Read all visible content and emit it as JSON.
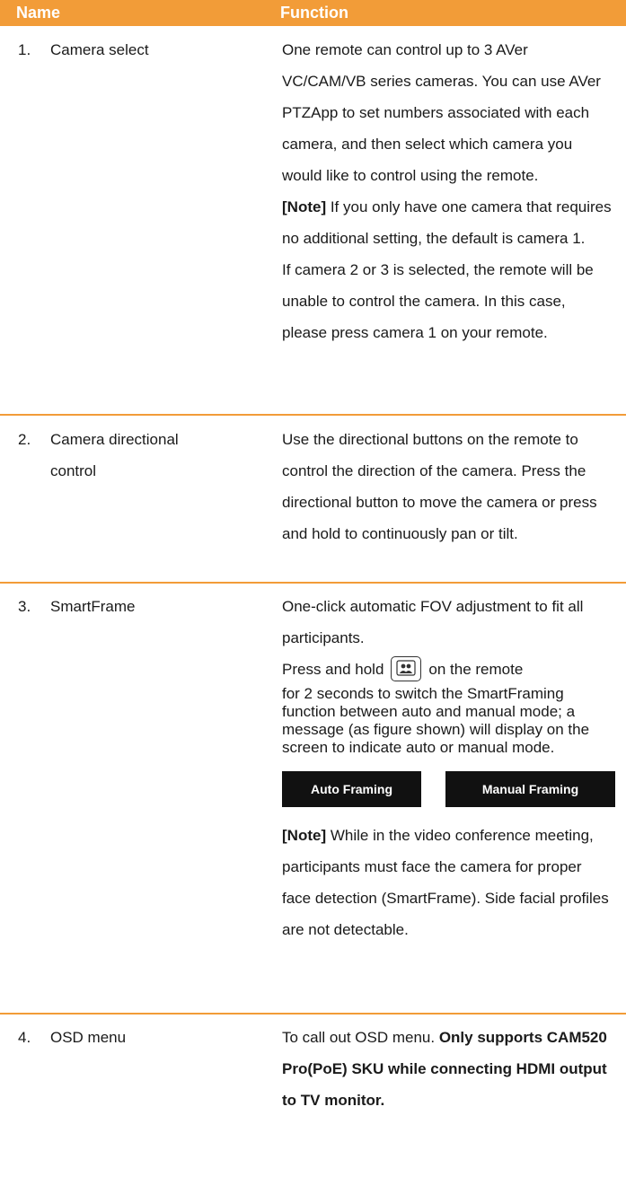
{
  "header": {
    "name": "Name",
    "function": "Function"
  },
  "rows": [
    {
      "num": "1.",
      "name": "Camera select",
      "desc": "One remote can control up to 3 AVer VC/CAM/VB series cameras. You can use AVer PTZApp to set numbers associated with each camera, and then select which camera you would like to control using the remote.",
      "note_label": "[Note]",
      "note_text": " If you only have one camera that requires no additional setting, the default is camera 1.",
      "extra": "If camera 2 or 3 is selected, the remote will be unable to control the camera. In this case, please press camera 1 on your remote."
    },
    {
      "num": "2.",
      "name_line1": "Camera directional",
      "name_line2": "control",
      "desc": "Use the directional buttons on the remote to control the direction of the camera. Press the directional button to move the camera or press and hold to continuously pan or tilt."
    },
    {
      "num": "3.",
      "name": "SmartFrame",
      "desc": "One-click automatic FOV adjustment to fit all participants.",
      "press_before": "Press and hold",
      "press_after": "on the remote",
      "press_rest": "for 2 seconds to switch the SmartFraming function between auto and manual mode; a message (as figure shown) will display on the screen to indicate auto or manual mode.",
      "badge_auto": "Auto Framing",
      "badge_manual": "Manual Framing",
      "note_label": "[Note]",
      "note_text": " While in the video conference meeting, participants must face the camera for proper face detection (SmartFrame). Side facial profiles are not detectable.",
      "icon": "smartframe-icon"
    },
    {
      "num": "4.",
      "name": "OSD menu",
      "desc": "To call out OSD menu. ",
      "desc_bold": "Only supports CAM520 Pro(PoE) SKU while connecting HDMI output to TV monitor."
    }
  ],
  "colors": {
    "accent": "#f29c38",
    "badge_bg": "#111111"
  }
}
